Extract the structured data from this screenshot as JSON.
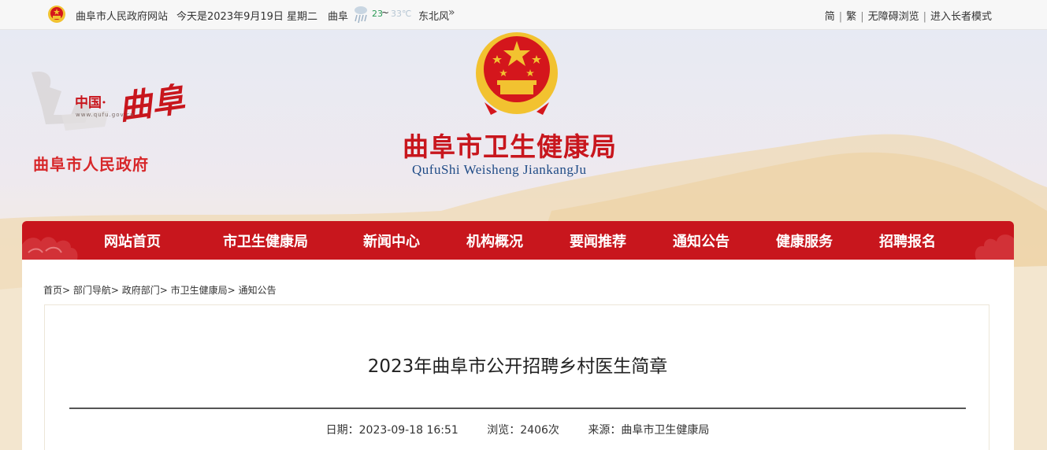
{
  "topbar": {
    "site_name": "曲阜市人民政府网站",
    "date_text": "今天是2023年9月19日 星期二",
    "city": "曲阜",
    "temp_low": "23",
    "temp_sep": "~",
    "temp_high": "33℃",
    "wind": "东北风",
    "more_glyph": "»",
    "links": [
      "简",
      "繁",
      "无障碍浏览",
      "进入长者模式"
    ],
    "link_separator": "|"
  },
  "banner": {
    "logo_country": "中国·",
    "logo_callig": "曲阜",
    "logo_url": "www.qufu.gov.cn",
    "gov_name": "曲阜市人民政府",
    "bureau_title": "曲阜市卫生健康局",
    "bureau_pinyin": "QufuShi Weisheng JiankangJu"
  },
  "nav": {
    "items": [
      "网站首页",
      "市卫生健康局",
      "新闻中心",
      "机构概况",
      "要闻推荐",
      "通知公告",
      "健康服务",
      "招聘报名"
    ]
  },
  "breadcrumb": [
    "首页>",
    "部门导航>",
    "政府部门>",
    "市卫生健康局>",
    "通知公告"
  ],
  "article": {
    "title": "2023年曲阜市公开招聘乡村医生简章",
    "date_label": "日期：2023-09-18 16:51",
    "views_label": "浏览：2406次",
    "source_label": "来源：曲阜市卫生健康局"
  },
  "colors": {
    "brand_red": "#c8161d",
    "pinyin_blue": "#1f4b86",
    "emblem_gold": "#f2c230"
  }
}
